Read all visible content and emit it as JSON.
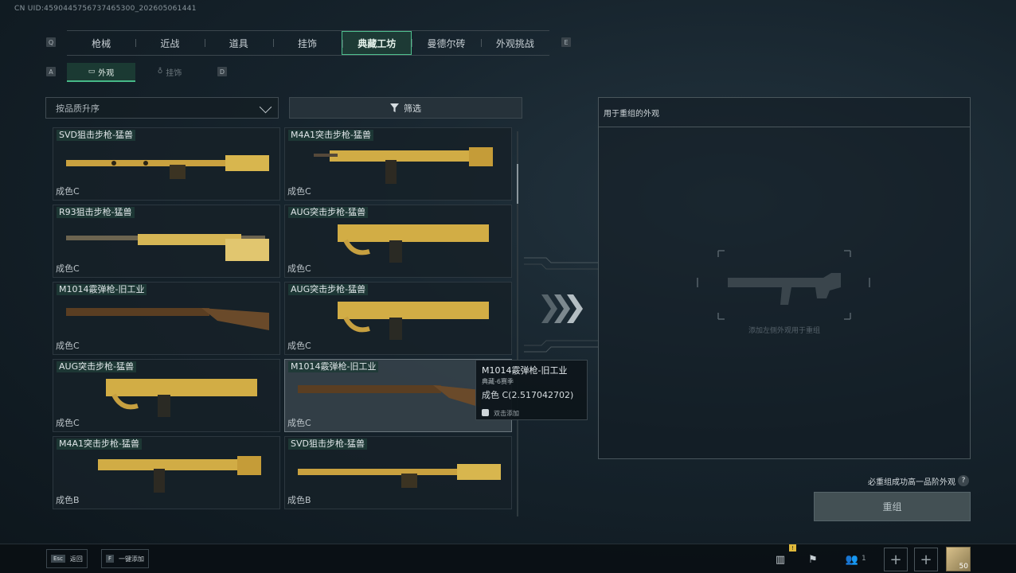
{
  "uid": "CN UID:4590445756737465300_202605061441",
  "tabs": {
    "left_key": "Q",
    "right_key": "E",
    "items": [
      "枪械",
      "近战",
      "道具",
      "挂饰",
      "典藏工坊",
      "曼德尔砖",
      "外观挑战"
    ],
    "active": "典藏工坊"
  },
  "subtabs": {
    "left_key": "A",
    "right_key": "D",
    "appearance": "外观",
    "pendant": "挂饰"
  },
  "sort": {
    "value": "按品质升序"
  },
  "filter": {
    "label": "筛选"
  },
  "items": [
    {
      "name": "SVD狙击步枪-猛兽",
      "grade": "成色C"
    },
    {
      "name": "M4A1突击步枪-猛兽",
      "grade": "成色C"
    },
    {
      "name": "R93狙击步枪-猛兽",
      "grade": "成色C"
    },
    {
      "name": "AUG突击步枪-猛兽",
      "grade": "成色C"
    },
    {
      "name": "M1014霰弹枪-旧工业",
      "grade": "成色C"
    },
    {
      "name": "AUG突击步枪-猛兽",
      "grade": "成色C"
    },
    {
      "name": "AUG突击步枪-猛兽",
      "grade": "成色C"
    },
    {
      "name": "M1014霰弹枪-旧工业",
      "grade": "成色C"
    },
    {
      "name": "M4A1突击步枪-猛兽",
      "grade": "成色B"
    },
    {
      "name": "SVD狙击步枪-猛兽",
      "grade": "成色B"
    }
  ],
  "tooltip": {
    "title": "M1014霰弹枪-旧工业",
    "subtitle": "典藏-6赛季",
    "grade": "成色 C(2.517042702)",
    "action": "双击添加"
  },
  "right_panel": {
    "title": "用于重组的外观",
    "hint": "添加左侧外观用于重组"
  },
  "note": "必重组成功高一品阶外观",
  "help": "?",
  "recombine_button": "重组",
  "bottom": {
    "esc_key": "Esc",
    "esc_label": "返回",
    "f_key": "F",
    "f_label": "一键添加",
    "friends_count": "1",
    "level": "50",
    "notif": "!"
  },
  "colors": {
    "accent": "#4fc08f",
    "gold": "#d9b24a"
  }
}
